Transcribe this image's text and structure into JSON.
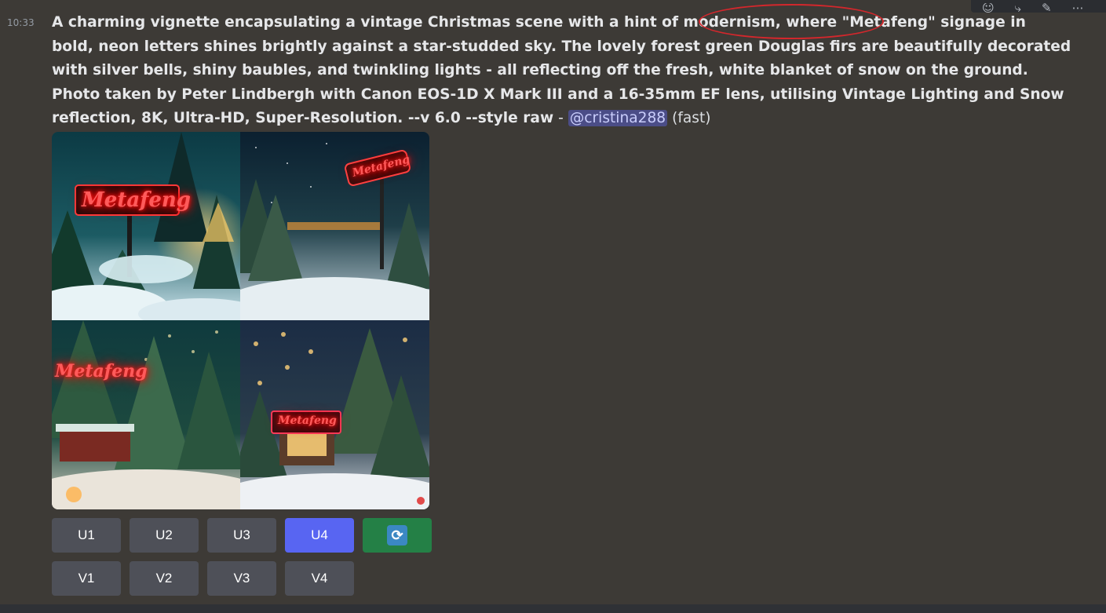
{
  "timestamp": "10:33",
  "message": {
    "prompt": "A charming vignette encapsulating a vintage Christmas scene with a hint of modernism, where \"Metafeng\" signage in bold, neon letters shines brightly against a star-studded sky. The lovely forest green Douglas firs are beautifully decorated with silver bells, shiny baubles, and twinkling lights - all reflecting off the fresh, white blanket of snow on the ground. Photo taken by Peter Lindbergh with Canon EOS-1D X Mark III and a 16-35mm EF lens, utilising Vintage Lighting and Snow reflection, 8K, Ultra-HD, Super-Resolution. --v 6.0 --style raw",
    "separator": " - ",
    "mention": "@cristina288",
    "speed": "(fast)"
  },
  "image_grid": {
    "sign_text": "Metafeng",
    "tiles": [
      "tile-1",
      "tile-2",
      "tile-3",
      "tile-4"
    ]
  },
  "buttons": {
    "upscale": [
      "U1",
      "U2",
      "U3",
      "U4"
    ],
    "variation": [
      "V1",
      "V2",
      "V3",
      "V4"
    ],
    "selected_upscale": "U4",
    "reroll_icon": "refresh-icon"
  },
  "toolbar_icons": [
    "add-reaction-icon",
    "thread-icon",
    "edit-icon",
    "more-icon"
  ],
  "colors": {
    "background": "#3d3a36",
    "primary_button": "#5865f2",
    "secondary_button": "#4e5058",
    "success_button": "#248046",
    "mention_bg": "#4b4d87",
    "annotation_ellipse": "#d3272c",
    "neon": "#ff2020"
  }
}
